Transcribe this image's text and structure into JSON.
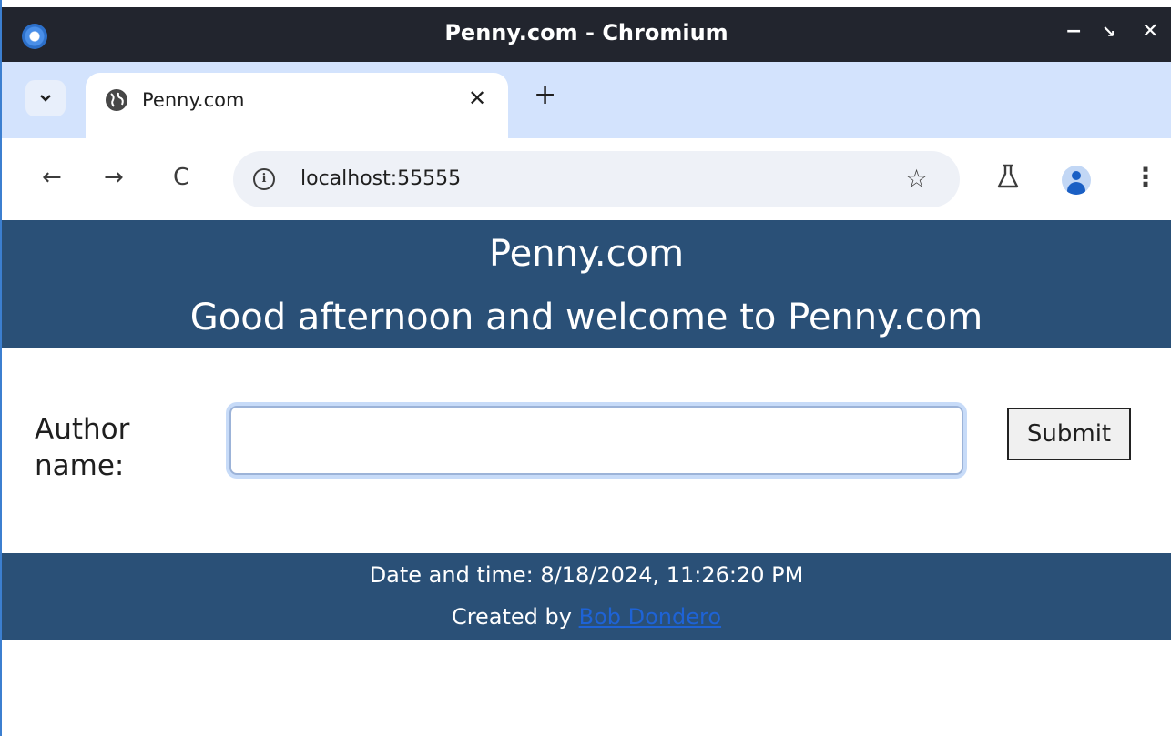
{
  "window": {
    "title": "Penny.com - Chromium",
    "controls": {
      "minimize": "−",
      "maximize": "↘",
      "close": "✕"
    }
  },
  "tabs": {
    "list_icon": "chevron-down-icon",
    "items": [
      {
        "title": "Penny.com",
        "icon": "globe-icon",
        "close": "✕"
      }
    ],
    "new_tab": "+"
  },
  "toolbar": {
    "back": "←",
    "forward": "→",
    "reload": "C",
    "url": "localhost:55555",
    "info": "i",
    "bookmark": "☆",
    "labs": "⚗",
    "menu": "⋮"
  },
  "page": {
    "site_name": "Penny.com",
    "welcome": "Good afternoon and welcome to Penny.com",
    "form": {
      "label": "Author name:",
      "input_value": "",
      "submit_label": "Submit"
    },
    "footer": {
      "datetime": "Date and time: 8/18/2024, 11:26:20 PM",
      "created_prefix": "Created by",
      "author_link": "Bob Dondero"
    }
  },
  "colors": {
    "header_bg": "#2a5077",
    "titlebar_bg": "#22252e",
    "tabstrip_bg": "#d3e3fd",
    "link": "#1e63d6"
  }
}
